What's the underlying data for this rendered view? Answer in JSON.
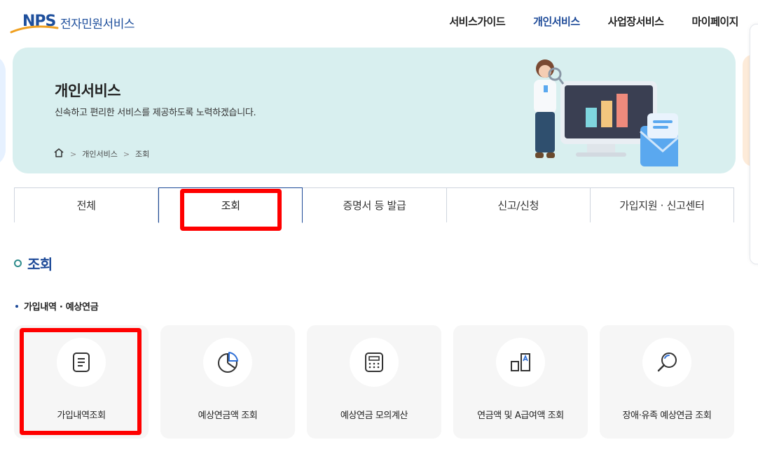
{
  "header": {
    "logo_mark": "NPS",
    "logo_text": "전자민원서비스",
    "nav": [
      {
        "label": "서비스가이드",
        "active": false
      },
      {
        "label": "개인서비스",
        "active": true
      },
      {
        "label": "사업장서비스",
        "active": false
      },
      {
        "label": "마이페이지",
        "active": false
      }
    ]
  },
  "banner": {
    "title": "개인서비스",
    "description": "신속하고 편리한 서비스를 제공하도록 노력하겠습니다.",
    "breadcrumb": {
      "home_icon": "home-icon",
      "items": [
        "개인서비스",
        "조회"
      ],
      "separator": ">"
    }
  },
  "tabs": [
    {
      "label": "전체",
      "active": false
    },
    {
      "label": "조회",
      "active": true
    },
    {
      "label": "증명서 등 발급",
      "active": false
    },
    {
      "label": "신고/신청",
      "active": false
    },
    {
      "label": "가입지원 · 신고센터",
      "active": false
    }
  ],
  "section": {
    "title": "조회",
    "subsection": "가입내역 · 예상연금"
  },
  "cards": [
    {
      "label": "가입내역조회",
      "icon": "document-icon"
    },
    {
      "label": "예상연금액 조회",
      "icon": "pie-chart-icon"
    },
    {
      "label": "예상연금 모의계산",
      "icon": "calculator-icon"
    },
    {
      "label": "연금액 및 A급여액 조회",
      "icon": "compare-icon"
    },
    {
      "label": "장애·유족 예상연금 조회",
      "icon": "magnifier-icon"
    }
  ],
  "colors": {
    "brand_blue": "#1d4a98",
    "banner_bg": "#d8efef",
    "highlight_red": "#ff0000",
    "card_bg": "#f6f6f6"
  }
}
